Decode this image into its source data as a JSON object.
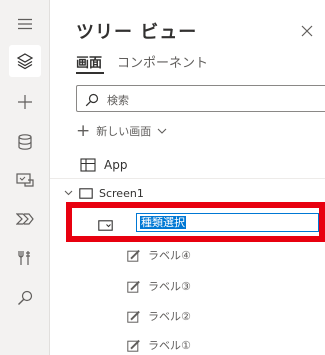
{
  "rail": {
    "items": [
      {
        "name": "menu",
        "icon": "hamburger-icon"
      },
      {
        "name": "tree-view",
        "icon": "layers-icon",
        "active": true
      },
      {
        "name": "insert",
        "icon": "plus-icon"
      },
      {
        "name": "data",
        "icon": "database-icon"
      },
      {
        "name": "media",
        "icon": "media-icon"
      },
      {
        "name": "power-automate",
        "icon": "flow-icon"
      },
      {
        "name": "advanced-tools",
        "icon": "tools-icon"
      },
      {
        "name": "search",
        "icon": "search-icon"
      }
    ]
  },
  "pane": {
    "title": "ツリー ビュー",
    "tabs": [
      {
        "label": "画面",
        "active": true
      },
      {
        "label": "コンポーネント",
        "active": false
      }
    ],
    "search": {
      "placeholder": "検索"
    },
    "new_screen": {
      "label": "新しい画面"
    },
    "tree": {
      "app": {
        "label": "App"
      },
      "screen": {
        "label": "Screen1"
      },
      "selected_control": {
        "name": "種類選択",
        "icon": "dropdown-icon"
      },
      "labels": [
        "ラベル④",
        "ラベル③",
        "ラベル②",
        "ラベル①"
      ]
    }
  },
  "colors": {
    "accent": "#0078d4",
    "highlight_border": "#e8000f",
    "rail_background": "#f3f2f1"
  }
}
